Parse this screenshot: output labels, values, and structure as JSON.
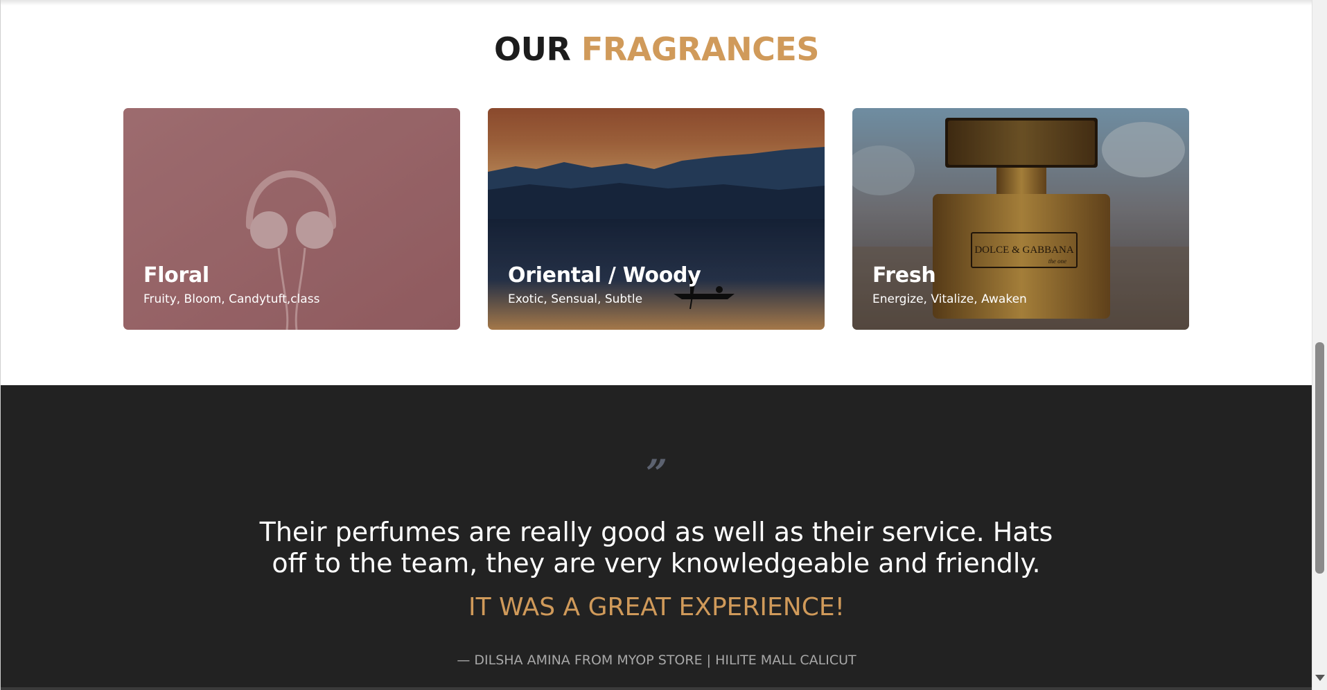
{
  "fragrances": {
    "title_dark": "OUR",
    "title_accent": "FRAGRANCES",
    "cards": [
      {
        "title": "Floral",
        "subtitle": "Fruity, Bloom, Candytuft,class",
        "image": "headphones-on-pink-image"
      },
      {
        "title": "Oriental / Woody",
        "subtitle": "Exotic, Sensual, Subtle",
        "image": "sunset-lake-boat-image"
      },
      {
        "title": "Fresh",
        "subtitle": "Energize, Vitalize, Awaken",
        "image": "perfume-bottle-image",
        "bottle_brand": "DOLCE & GABBANA",
        "bottle_sub": "the one"
      }
    ]
  },
  "testimonial": {
    "quote_mark": "”",
    "text": "Their perfumes are really good as well as their service. Hats off to the team, they are very knowledgeable and friendly.",
    "highlight": "IT WAS A GREAT EXPERIENCE!",
    "author": "— DILSHA AMINA FROM MYOP STORE | HILITE MALL CALICUT"
  },
  "colors": {
    "accent": "#d09a5a",
    "dark_section": "#222222",
    "title_dark": "#1c1c1c"
  }
}
